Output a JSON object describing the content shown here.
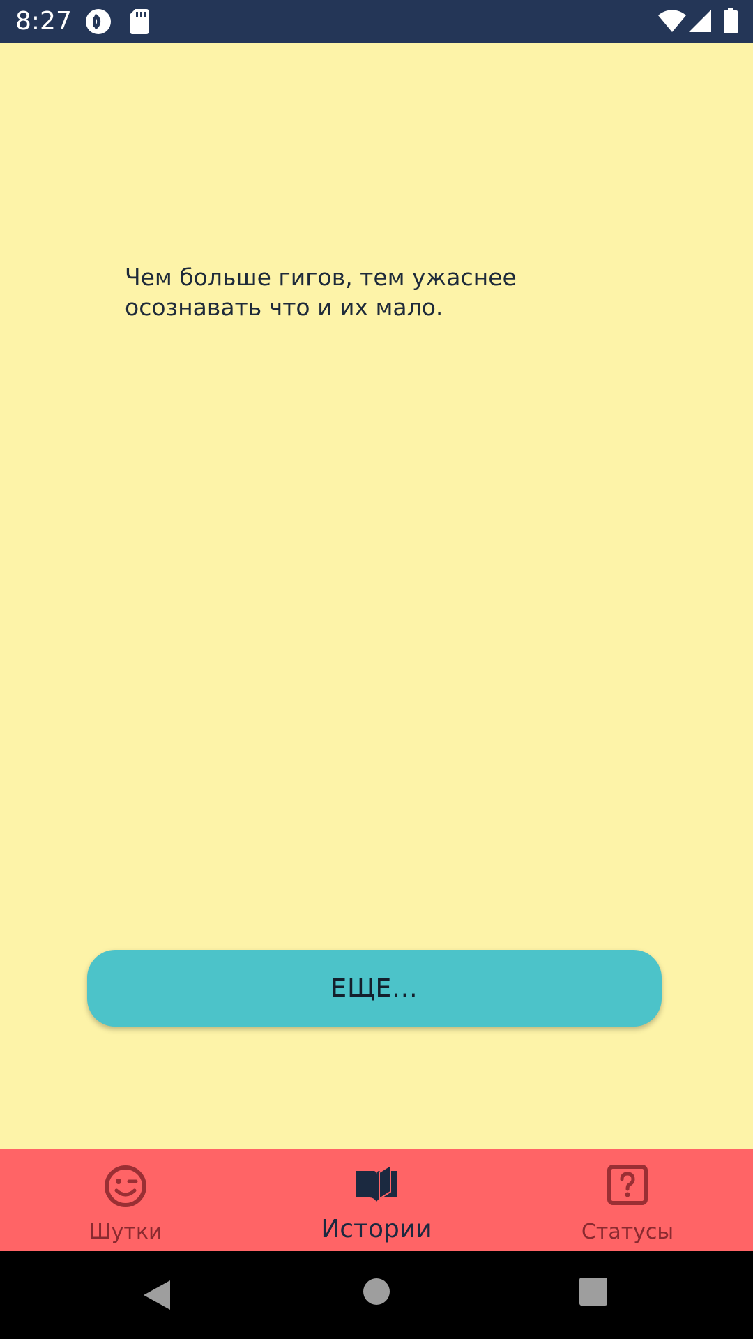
{
  "status_bar": {
    "time": "8:27",
    "icons": [
      "pocket-casts-icon",
      "sd-card-icon",
      "wifi-icon",
      "signal-icon",
      "battery-icon"
    ]
  },
  "main": {
    "text": "Чем больше гигов, тем ужаснее осознавать что и их мало.",
    "more_button_label": "ЕЩЕ..."
  },
  "bottom_nav": {
    "items": [
      {
        "label": "Шутки",
        "icon": "smile-icon",
        "active": false
      },
      {
        "label": "Истории",
        "icon": "book-icon",
        "active": true
      },
      {
        "label": "Статусы",
        "icon": "question-box-icon",
        "active": false
      }
    ]
  },
  "system_nav": {
    "buttons": [
      "back-icon",
      "home-icon",
      "recents-icon"
    ]
  },
  "colors": {
    "background": "#fdf3a8",
    "status_bar": "#243657",
    "button": "#4cc3c9",
    "bottom_nav": "#ff6466",
    "nav_inactive": "#8a2a30",
    "nav_active": "#1b2940"
  }
}
